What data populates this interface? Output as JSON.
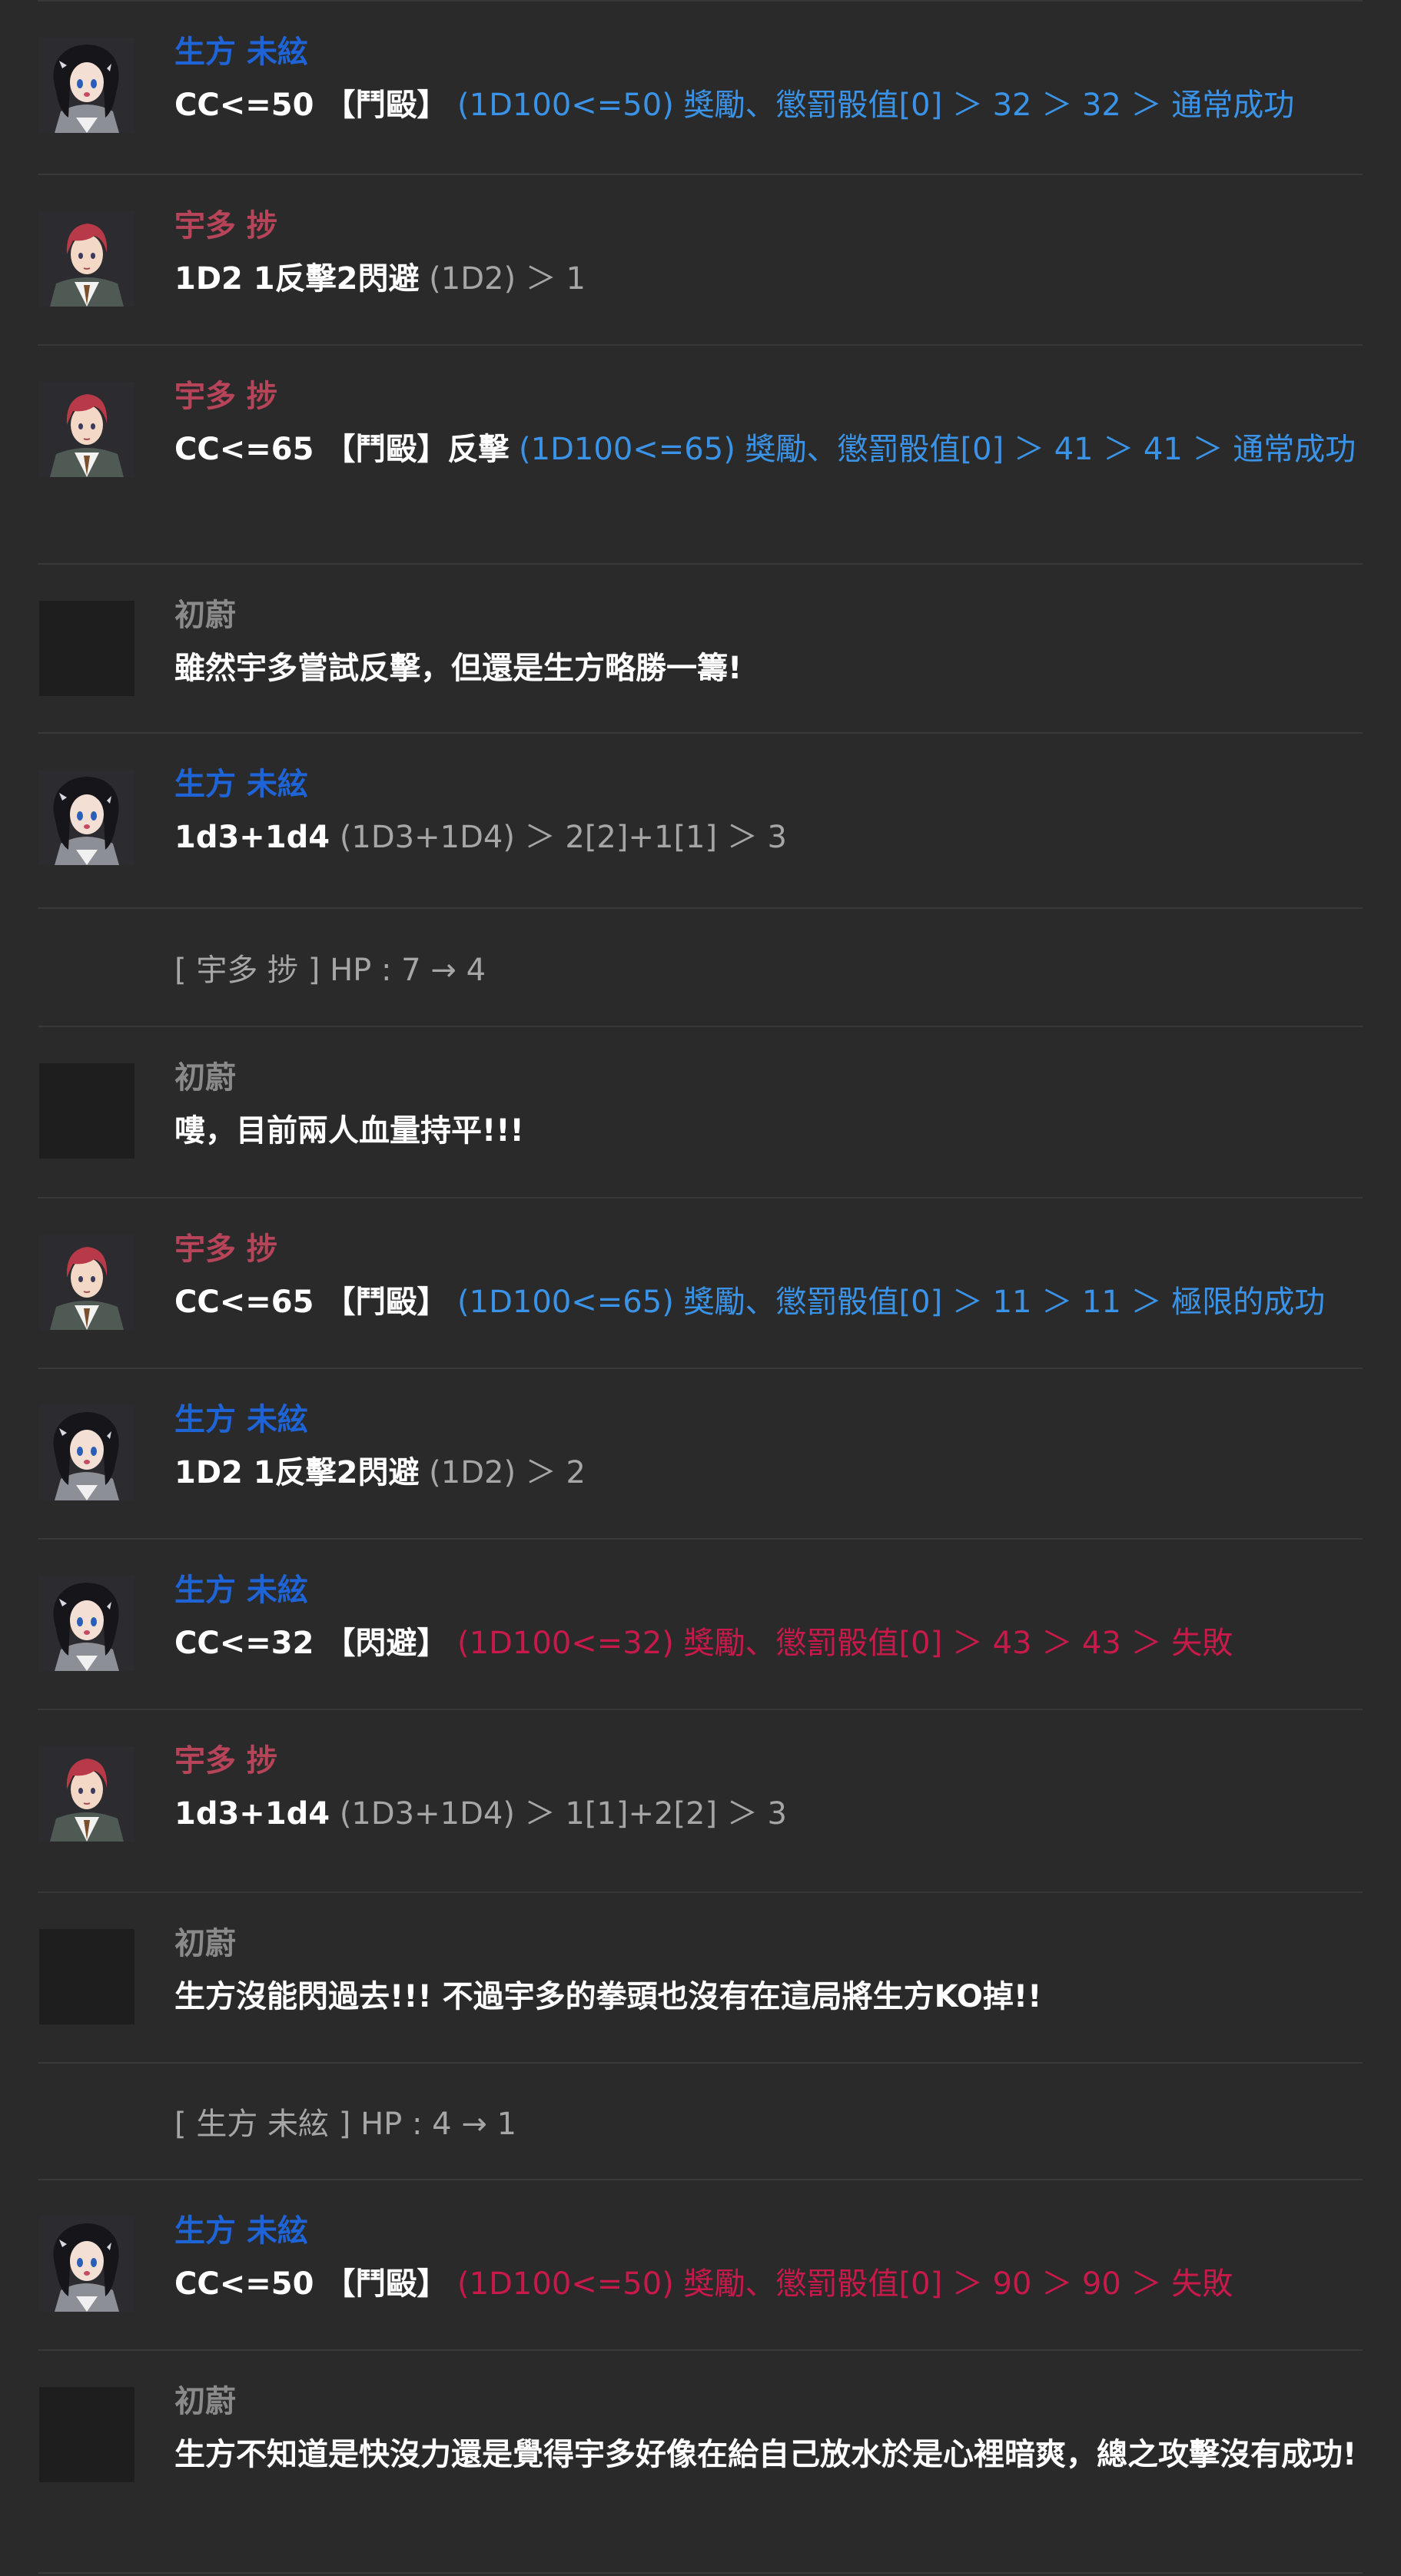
{
  "colors": {
    "background": "#2a2a2a",
    "divider": "#383838",
    "name_blue": "#1e64d6",
    "name_red": "#b84459",
    "name_gray": "#8a8a8a",
    "result_blue": "#3a93e6",
    "result_red": "#c8194b",
    "result_gray": "#a6a6a6"
  },
  "entries": [
    {
      "type": "chat",
      "avatar": "girl",
      "speaker": "生方 未絃",
      "speaker_color": "blue",
      "command": "CC<=50 【鬥毆】",
      "result": " (1D100<=50) 獎勵、懲罰骰值[0] ＞ 32 ＞ 32 ＞ 通常成功",
      "result_color": "blue"
    },
    {
      "type": "chat",
      "avatar": "boy",
      "speaker": "宇多 捗",
      "speaker_color": "red",
      "command": "1D2 1反擊2閃避",
      "result": " (1D2) ＞ 1",
      "result_color": "gray"
    },
    {
      "type": "chat",
      "avatar": "boy",
      "speaker": "宇多 捗",
      "speaker_color": "red",
      "command": "CC<=65 【鬥毆】反擊",
      "result": " (1D100<=65) 獎勵、懲罰骰值[0] ＞ 41 ＞ 41 ＞ 通常成功",
      "result_color": "blue"
    },
    {
      "type": "narration",
      "avatar": "empty",
      "speaker": "初蔚",
      "speaker_color": "gray",
      "text": "雖然宇多嘗試反擊，但還是生方略勝一籌!"
    },
    {
      "type": "chat",
      "avatar": "girl",
      "speaker": "生方 未絃",
      "speaker_color": "blue",
      "command": "1d3+1d4",
      "result": " (1D3+1D4) ＞ 2[2]+1[1] ＞ 3",
      "result_color": "gray"
    },
    {
      "type": "system",
      "text": "[ 宇多 捗 ] HP : 7 → 4"
    },
    {
      "type": "narration",
      "avatar": "empty",
      "speaker": "初蔚",
      "speaker_color": "gray",
      "text": "嘍，目前兩人血量持平!!!"
    },
    {
      "type": "chat",
      "avatar": "boy",
      "speaker": "宇多 捗",
      "speaker_color": "red",
      "command": "CC<=65 【鬥毆】",
      "result": " (1D100<=65) 獎勵、懲罰骰值[0] ＞ 11 ＞ 11 ＞ 極限的成功",
      "result_color": "blue"
    },
    {
      "type": "chat",
      "avatar": "girl",
      "speaker": "生方 未絃",
      "speaker_color": "blue",
      "command": "1D2 1反擊2閃避",
      "result": " (1D2) ＞ 2",
      "result_color": "gray"
    },
    {
      "type": "chat",
      "avatar": "girl",
      "speaker": "生方 未絃",
      "speaker_color": "blue",
      "command": "CC<=32 【閃避】",
      "result": " (1D100<=32) 獎勵、懲罰骰值[0] ＞ 43 ＞ 43 ＞ 失敗",
      "result_color": "red"
    },
    {
      "type": "chat",
      "avatar": "boy",
      "speaker": "宇多 捗",
      "speaker_color": "red",
      "command": "1d3+1d4",
      "result": " (1D3+1D4) ＞ 1[1]+2[2] ＞ 3",
      "result_color": "gray"
    },
    {
      "type": "narration",
      "avatar": "empty",
      "speaker": "初蔚",
      "speaker_color": "gray",
      "text": "生方沒能閃過去!!! 不過宇多的拳頭也沒有在這局將生方KO掉!!"
    },
    {
      "type": "system",
      "text": "[ 生方 未絃 ] HP : 4 → 1"
    },
    {
      "type": "chat",
      "avatar": "girl",
      "speaker": "生方 未絃",
      "speaker_color": "blue",
      "command": "CC<=50 【鬥毆】",
      "result": " (1D100<=50) 獎勵、懲罰骰值[0] ＞ 90 ＞ 90 ＞ 失敗",
      "result_color": "red"
    },
    {
      "type": "narration",
      "avatar": "empty",
      "speaker": "初蔚",
      "speaker_color": "gray",
      "text": "生方不知道是快沒力還是覺得宇多好像在給自己放水於是心裡暗爽，總之攻擊沒有成功!"
    }
  ]
}
